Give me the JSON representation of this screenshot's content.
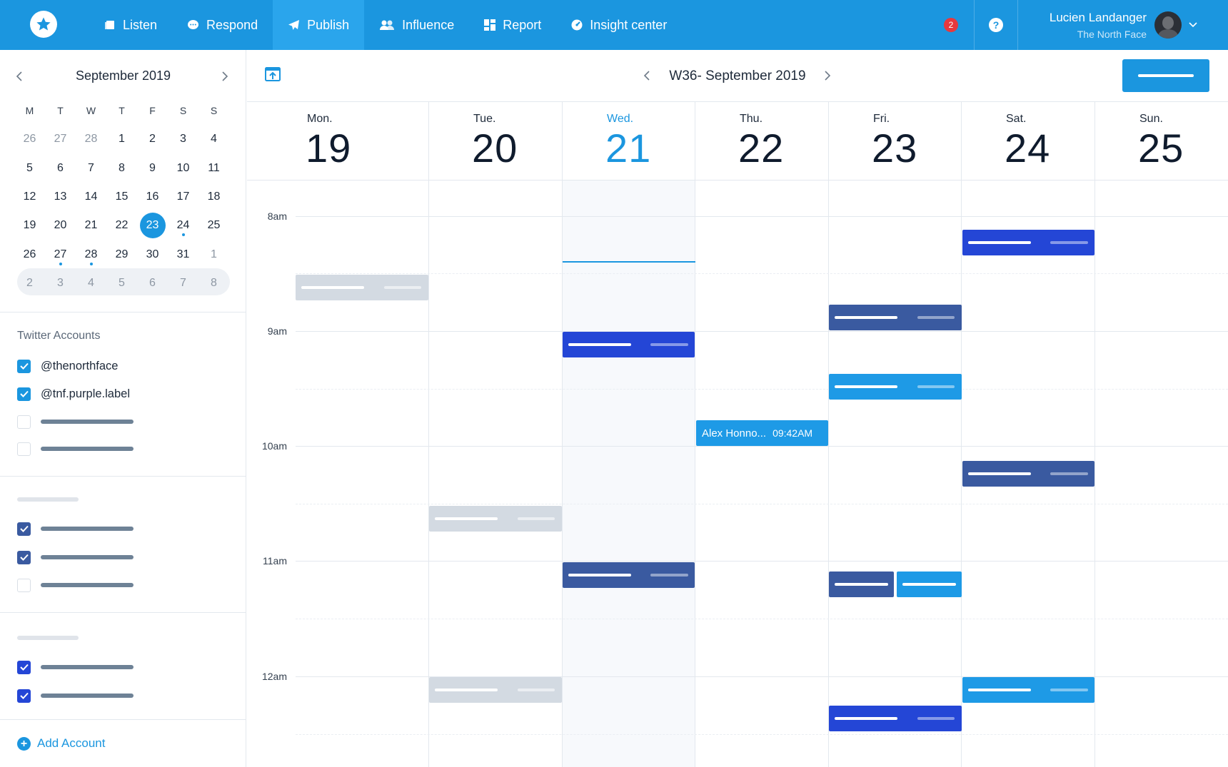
{
  "nav": {
    "items": [
      {
        "label": "Listen",
        "icon": "listen-icon"
      },
      {
        "label": "Respond",
        "icon": "chat-bubble-icon"
      },
      {
        "label": "Publish",
        "icon": "paper-plane-icon"
      },
      {
        "label": "Influence",
        "icon": "people-icon"
      },
      {
        "label": "Report",
        "icon": "dashboard-icon"
      },
      {
        "label": "Insight center",
        "icon": "gauge-icon"
      }
    ],
    "active": "Publish",
    "notification_count": "2",
    "help_label": "?",
    "user_name": "Lucien Landanger",
    "user_org": "The North Face"
  },
  "mini_calendar": {
    "title": "September 2019",
    "weekdays": [
      "M",
      "T",
      "W",
      "T",
      "F",
      "S",
      "S"
    ],
    "weeks": [
      [
        "26",
        "27",
        "28",
        "1",
        "2",
        "3",
        "4"
      ],
      [
        "5",
        "6",
        "7",
        "8",
        "9",
        "10",
        "11"
      ],
      [
        "12",
        "13",
        "14",
        "15",
        "16",
        "17",
        "18"
      ],
      [
        "19",
        "20",
        "21",
        "22",
        "23",
        "24",
        "25"
      ],
      [
        "26",
        "27",
        "28",
        "29",
        "30",
        "31",
        "1"
      ],
      [
        "2",
        "3",
        "4",
        "5",
        "6",
        "7",
        "8"
      ]
    ],
    "selected": "23"
  },
  "accounts": {
    "section_title": "Twitter Accounts",
    "items": [
      {
        "label": "@thenorthface",
        "checked": true
      },
      {
        "label": "@tnf.purple.label",
        "checked": true
      }
    ],
    "add_label": "Add Account"
  },
  "week": {
    "title": "W36- September 2019",
    "days": [
      {
        "name": "Mon.",
        "num": "19"
      },
      {
        "name": "Tue.",
        "num": "20"
      },
      {
        "name": "Wed.",
        "num": "21"
      },
      {
        "name": "Thu.",
        "num": "22"
      },
      {
        "name": "Fri.",
        "num": "23"
      },
      {
        "name": "Sat.",
        "num": "24"
      },
      {
        "name": "Sun.",
        "num": "25"
      }
    ],
    "today": "Wed.",
    "hours": [
      "8am",
      "9am",
      "10am",
      "11am",
      "12am"
    ]
  },
  "events": {
    "named": {
      "title": "Alex Honno...",
      "time": "09:42AM"
    }
  },
  "colors": {
    "brand": "#1b96df",
    "royal": "#2446d6",
    "navy": "#3a5aa0",
    "gray": "#d3dae2",
    "notification": "#e8383d"
  }
}
